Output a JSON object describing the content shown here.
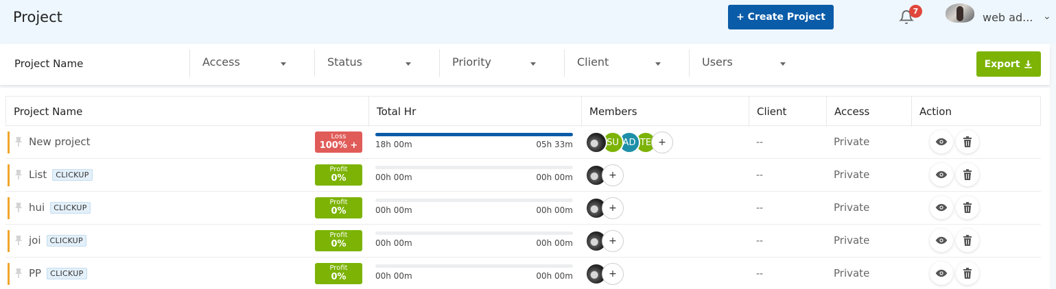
{
  "header": {
    "title": "Project",
    "create_label": "+ Create Project",
    "notification_count": "7",
    "user_name": "web ad..."
  },
  "filters": {
    "name_label": "Project Name",
    "items": [
      {
        "label": "Access"
      },
      {
        "label": "Status"
      },
      {
        "label": "Priority"
      },
      {
        "label": "Client"
      },
      {
        "label": "Users"
      }
    ],
    "export_label": "Export"
  },
  "table": {
    "columns": [
      "Project Name",
      "Total Hr",
      "Members",
      "Client",
      "Access",
      "Action"
    ],
    "rows": [
      {
        "name": "New project",
        "tag": "",
        "status_label": "Loss",
        "status_value": "100% +",
        "status_color": "#e05c59",
        "hr_left": "18h 00m",
        "hr_right": "05h 33m",
        "progress": 1.0,
        "members": [
          "photo",
          "SU",
          "AD",
          "TE"
        ],
        "client": "--",
        "access": "Private"
      },
      {
        "name": "List",
        "tag": "CLICKUP",
        "status_label": "Profit",
        "status_value": "0%",
        "status_color": "#7cb305",
        "hr_left": "00h 00m",
        "hr_right": "00h 00m",
        "progress": 0,
        "members": [
          "photo"
        ],
        "client": "--",
        "access": "Private"
      },
      {
        "name": "hui",
        "tag": "CLICKUP",
        "status_label": "Profit",
        "status_value": "0%",
        "status_color": "#7cb305",
        "hr_left": "00h 00m",
        "hr_right": "00h 00m",
        "progress": 0,
        "members": [
          "photo"
        ],
        "client": "--",
        "access": "Private"
      },
      {
        "name": "joi",
        "tag": "CLICKUP",
        "status_label": "Profit",
        "status_value": "0%",
        "status_color": "#7cb305",
        "hr_left": "00h 00m",
        "hr_right": "00h 00m",
        "progress": 0,
        "members": [
          "photo"
        ],
        "client": "--",
        "access": "Private"
      },
      {
        "name": "PP",
        "tag": "CLICKUP",
        "status_label": "Profit",
        "status_value": "0%",
        "status_color": "#7cb305",
        "hr_left": "00h 00m",
        "hr_right": "00h 00m",
        "progress": 0,
        "members": [
          "photo"
        ],
        "client": "--",
        "access": "Private"
      }
    ],
    "member_colors": {
      "SU": "#7cb305",
      "AD": "#1e8fa8",
      "TE": "#7cb305"
    },
    "add_member_label": "+"
  },
  "icons": {
    "bell": "bell-icon",
    "export": "download-icon",
    "view": "eye-icon",
    "delete": "trash-icon",
    "pin": "pin-icon"
  },
  "colors": {
    "primary": "#0b5ca8",
    "success": "#7cb305",
    "danger": "#e05c59",
    "accent": "#f1a52b"
  }
}
